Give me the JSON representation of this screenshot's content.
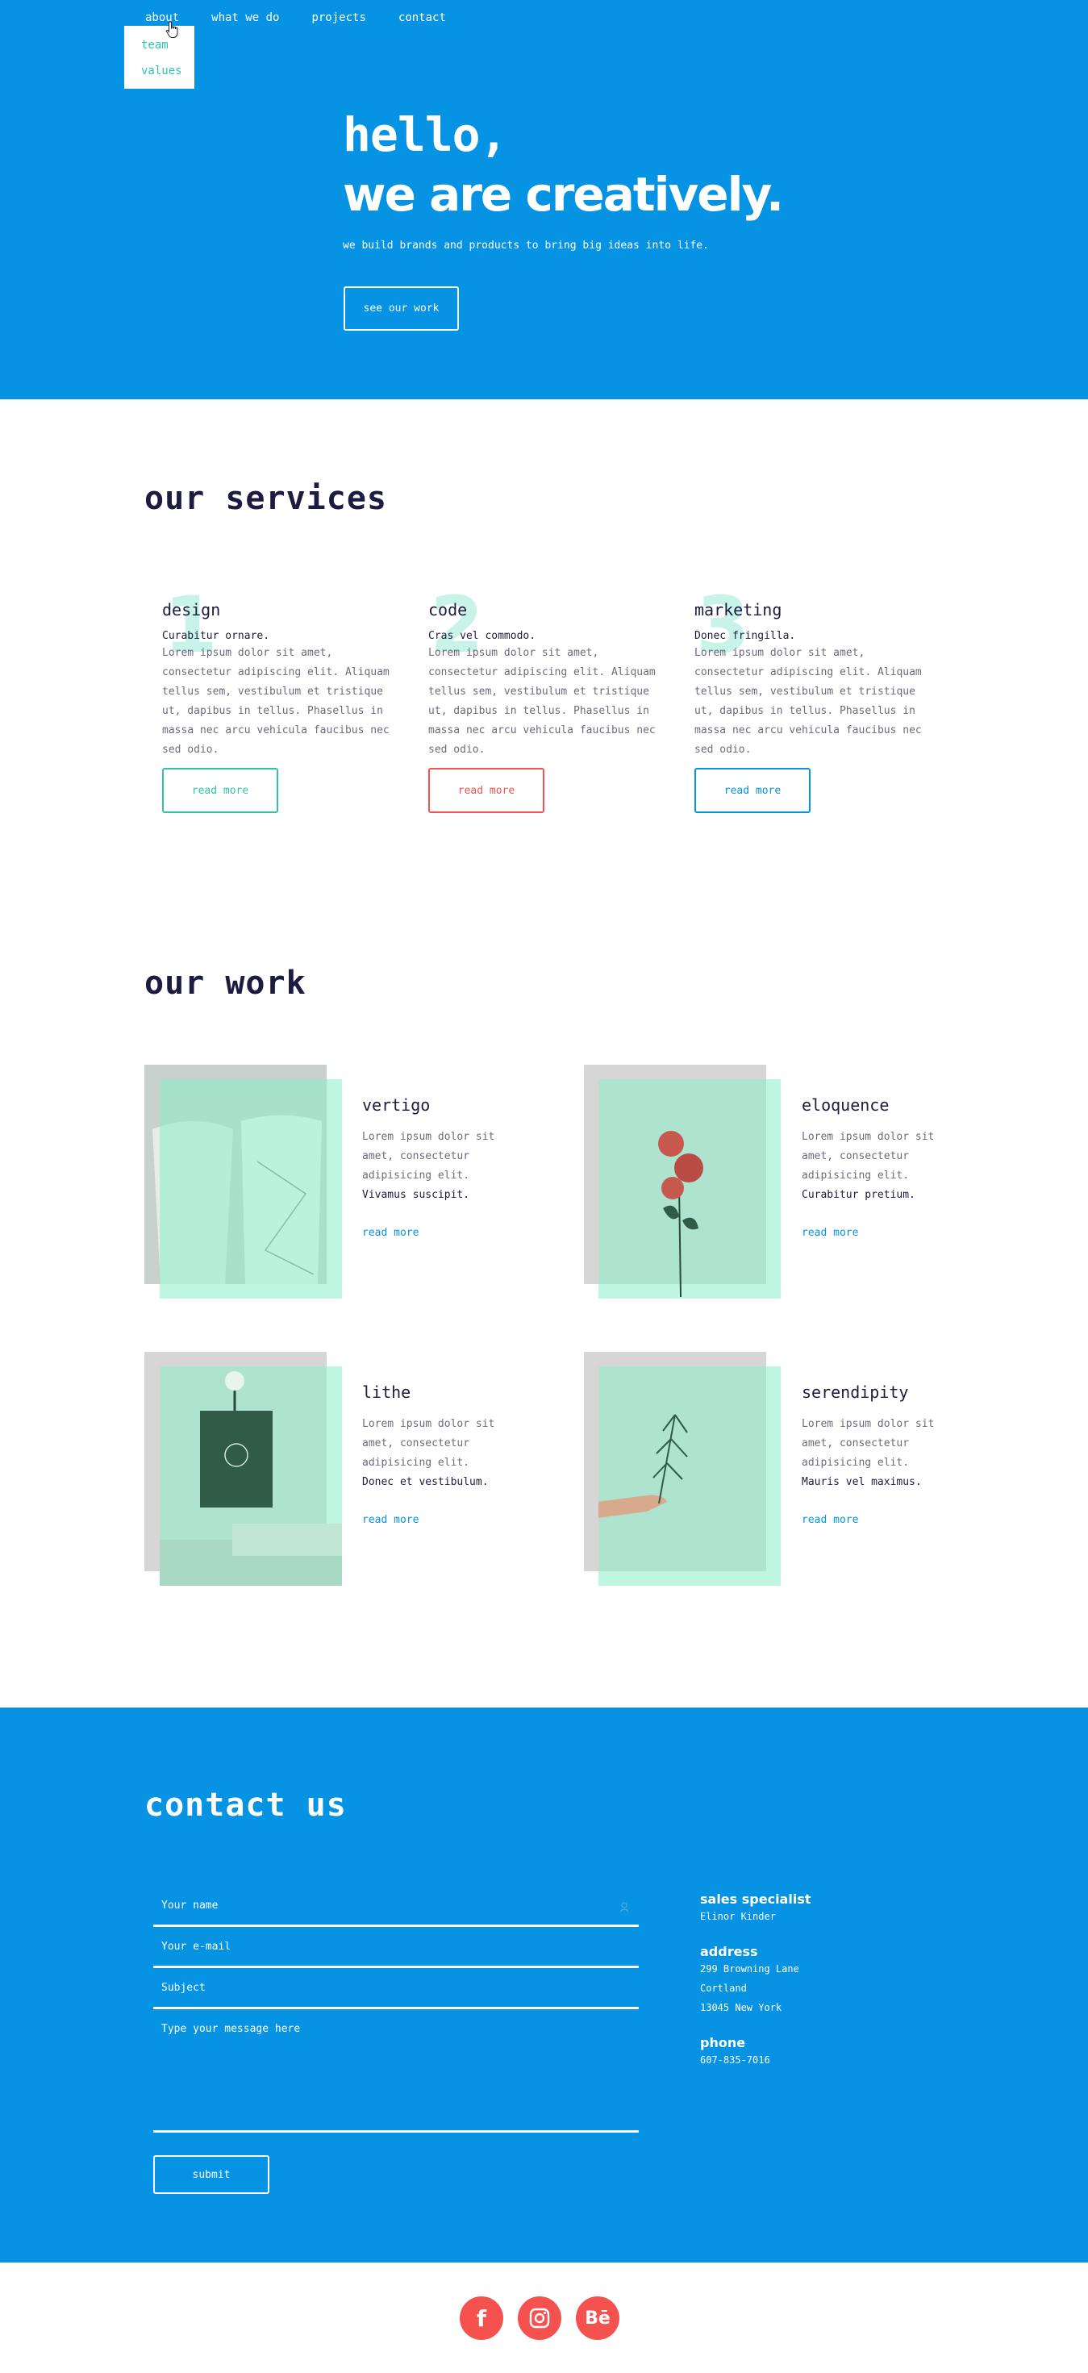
{
  "nav": {
    "items": [
      "about",
      "what we do",
      "projects",
      "contact"
    ],
    "dropdown": [
      "team",
      "values"
    ]
  },
  "hero": {
    "line1": "hello,",
    "line2_pre": "we are ",
    "line2_bold": "creatively",
    "line2_post": ".",
    "subtitle": "we build brands and products to bring big ideas into life.",
    "button": "see our work"
  },
  "services": {
    "title": "our services",
    "items": [
      {
        "num": "1",
        "title": "design",
        "lead": "Curabitur ornare.",
        "desc": "Lorem ipsum dolor sit amet, consectetur adipiscing elit. Aliquam tellus sem, vestibulum et tristique ut, dapibus in tellus. Phasellus in massa nec arcu vehicula faucibus nec sed odio.",
        "button": "read more",
        "color": "#2ec4a6"
      },
      {
        "num": "2",
        "title": "code",
        "lead": "Cras vel commodo.",
        "desc": "Lorem ipsum dolor sit amet, consectetur adipiscing elit. Aliquam tellus sem, vestibulum et tristique ut, dapibus in tellus. Phasellus in massa nec arcu vehicula faucibus nec sed odio.",
        "button": "read more",
        "color": "#f5514f"
      },
      {
        "num": "3",
        "title": "marketing",
        "lead": "Donec fringilla.",
        "desc": "Lorem ipsum dolor sit amet, consectetur adipiscing elit. Aliquam tellus sem, vestibulum et tristique ut, dapibus in tellus. Phasellus in massa nec arcu vehicula faucibus nec sed odio.",
        "button": "read more",
        "color": "#0693e3"
      }
    ]
  },
  "work": {
    "title": "our work",
    "items": [
      {
        "title": "vertigo",
        "desc": "Lorem ipsum dolor sit amet, consectetur adipisicing elit.",
        "bold": "Vivamus suscipit.",
        "link": "read more"
      },
      {
        "title": "eloquence",
        "desc": "Lorem ipsum dolor sit amet, consectetur adipisicing elit.",
        "bold": "Curabitur pretium.",
        "link": "read more"
      },
      {
        "title": "lithe",
        "desc": "Lorem ipsum dolor sit amet, consectetur adipisicing elit.",
        "bold": "Donec et vestibulum.",
        "link": "read more"
      },
      {
        "title": "serendipity",
        "desc": "Lorem ipsum dolor sit amet, consectetur adipisicing elit.",
        "bold": "Mauris vel maximus.",
        "link": "read more"
      }
    ]
  },
  "contact": {
    "title": "contact us",
    "placeholders": {
      "name": "Your name",
      "email": "Your e-mail",
      "subject": "Subject",
      "message": "Type your message here"
    },
    "submit": "submit",
    "sales_label": "sales specialist",
    "sales_name": "Elinor Kinder",
    "address_label": "address",
    "address_lines": [
      "299 Browning Lane",
      "Cortland",
      "13045 New York"
    ],
    "phone_label": "phone",
    "phone": "607-835-7016"
  },
  "footer": {
    "social": [
      {
        "icon": "facebook-icon",
        "glyph": "f"
      },
      {
        "icon": "instagram-icon",
        "glyph": ""
      },
      {
        "icon": "behance-icon",
        "glyph": "Bē"
      }
    ]
  },
  "colors": {
    "brand_blue": "#0693e3",
    "accent_green": "#2ec4a6",
    "accent_red": "#f5514f",
    "dark_text": "#1c1c40"
  }
}
